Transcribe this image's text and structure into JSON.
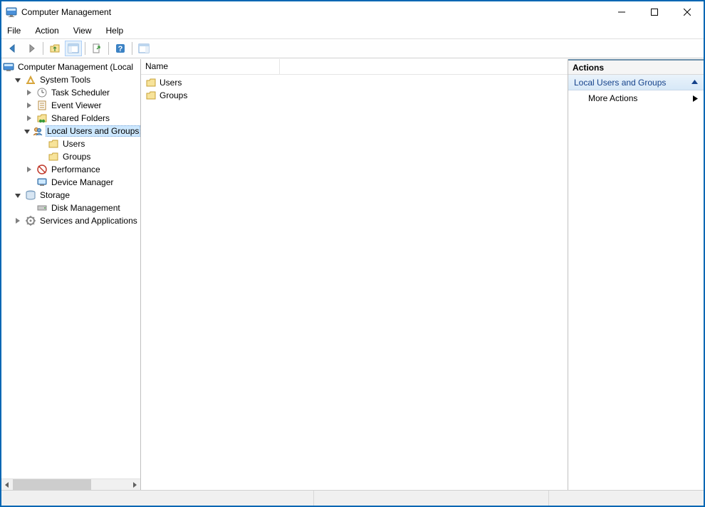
{
  "window": {
    "title": "Computer Management"
  },
  "menu": {
    "file": "File",
    "action": "Action",
    "view": "View",
    "help": "Help"
  },
  "tree": {
    "root": "Computer Management (Local",
    "systemTools": "System Tools",
    "taskScheduler": "Task Scheduler",
    "eventViewer": "Event Viewer",
    "sharedFolders": "Shared Folders",
    "localUsersGroups": "Local Users and Groups",
    "users": "Users",
    "groups": "Groups",
    "performance": "Performance",
    "deviceManager": "Device Manager",
    "storage": "Storage",
    "diskManagement": "Disk Management",
    "servicesApps": "Services and Applications"
  },
  "list": {
    "header_name": "Name",
    "items": [
      {
        "label": "Users"
      },
      {
        "label": "Groups"
      }
    ]
  },
  "actions": {
    "header": "Actions",
    "section": "Local Users and Groups",
    "more": "More Actions"
  }
}
